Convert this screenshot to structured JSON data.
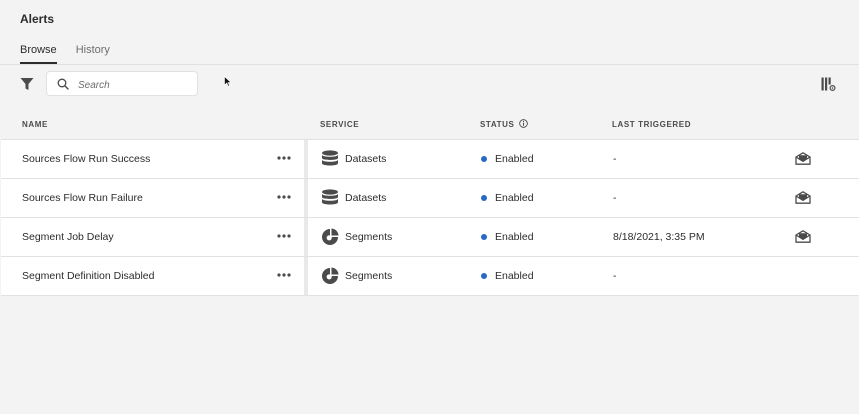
{
  "page": {
    "title": "Alerts"
  },
  "tabs": [
    {
      "label": "Browse",
      "active": true
    },
    {
      "label": "History",
      "active": false
    }
  ],
  "toolbar": {
    "search_placeholder": "Search"
  },
  "columns": {
    "name": "NAME",
    "service": "SERVICE",
    "status": "STATUS",
    "last_triggered": "LAST TRIGGERED"
  },
  "rows": [
    {
      "name": "Sources Flow Run Success",
      "service": "Datasets",
      "service_icon": "database-icon",
      "status": "Enabled",
      "last_triggered": "-",
      "subscribed": true
    },
    {
      "name": "Sources Flow Run Failure",
      "service": "Datasets",
      "service_icon": "database-icon",
      "status": "Enabled",
      "last_triggered": "-",
      "subscribed": true
    },
    {
      "name": "Segment Job Delay",
      "service": "Segments",
      "service_icon": "segments-icon",
      "status": "Enabled",
      "last_triggered": "8/18/2021, 3:35 PM",
      "subscribed": true
    },
    {
      "name": "Segment Definition Disabled",
      "service": "Segments",
      "service_icon": "segments-icon",
      "status": "Enabled",
      "last_triggered": "-",
      "subscribed": false
    }
  ],
  "colors": {
    "status_enabled": "#2a68c6",
    "text": "#2c2c2c",
    "background": "#f3f3f3"
  }
}
